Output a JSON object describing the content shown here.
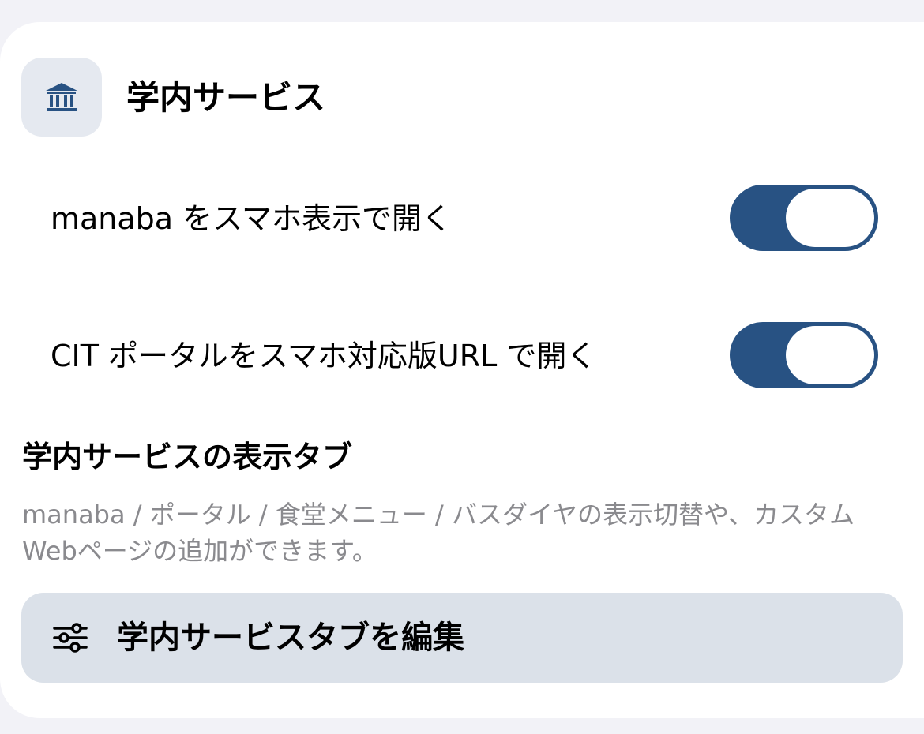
{
  "section": {
    "title": "学内サービス",
    "icon": "bank-building-icon",
    "accent_color": "#285283"
  },
  "settings": [
    {
      "label": "manaba をスマホ表示で開く",
      "enabled": true
    },
    {
      "label": "CIT ポータルをスマホ対応版URL で開く",
      "enabled": true
    }
  ],
  "tabs_section": {
    "title": "学内サービスの表示タブ",
    "description": "manaba / ポータル / 食堂メニュー / バスダイヤの表示切替や、カスタムWebページの追加ができます。"
  },
  "edit_button": {
    "label": "学内サービスタブを編集",
    "icon": "sliders-icon"
  }
}
